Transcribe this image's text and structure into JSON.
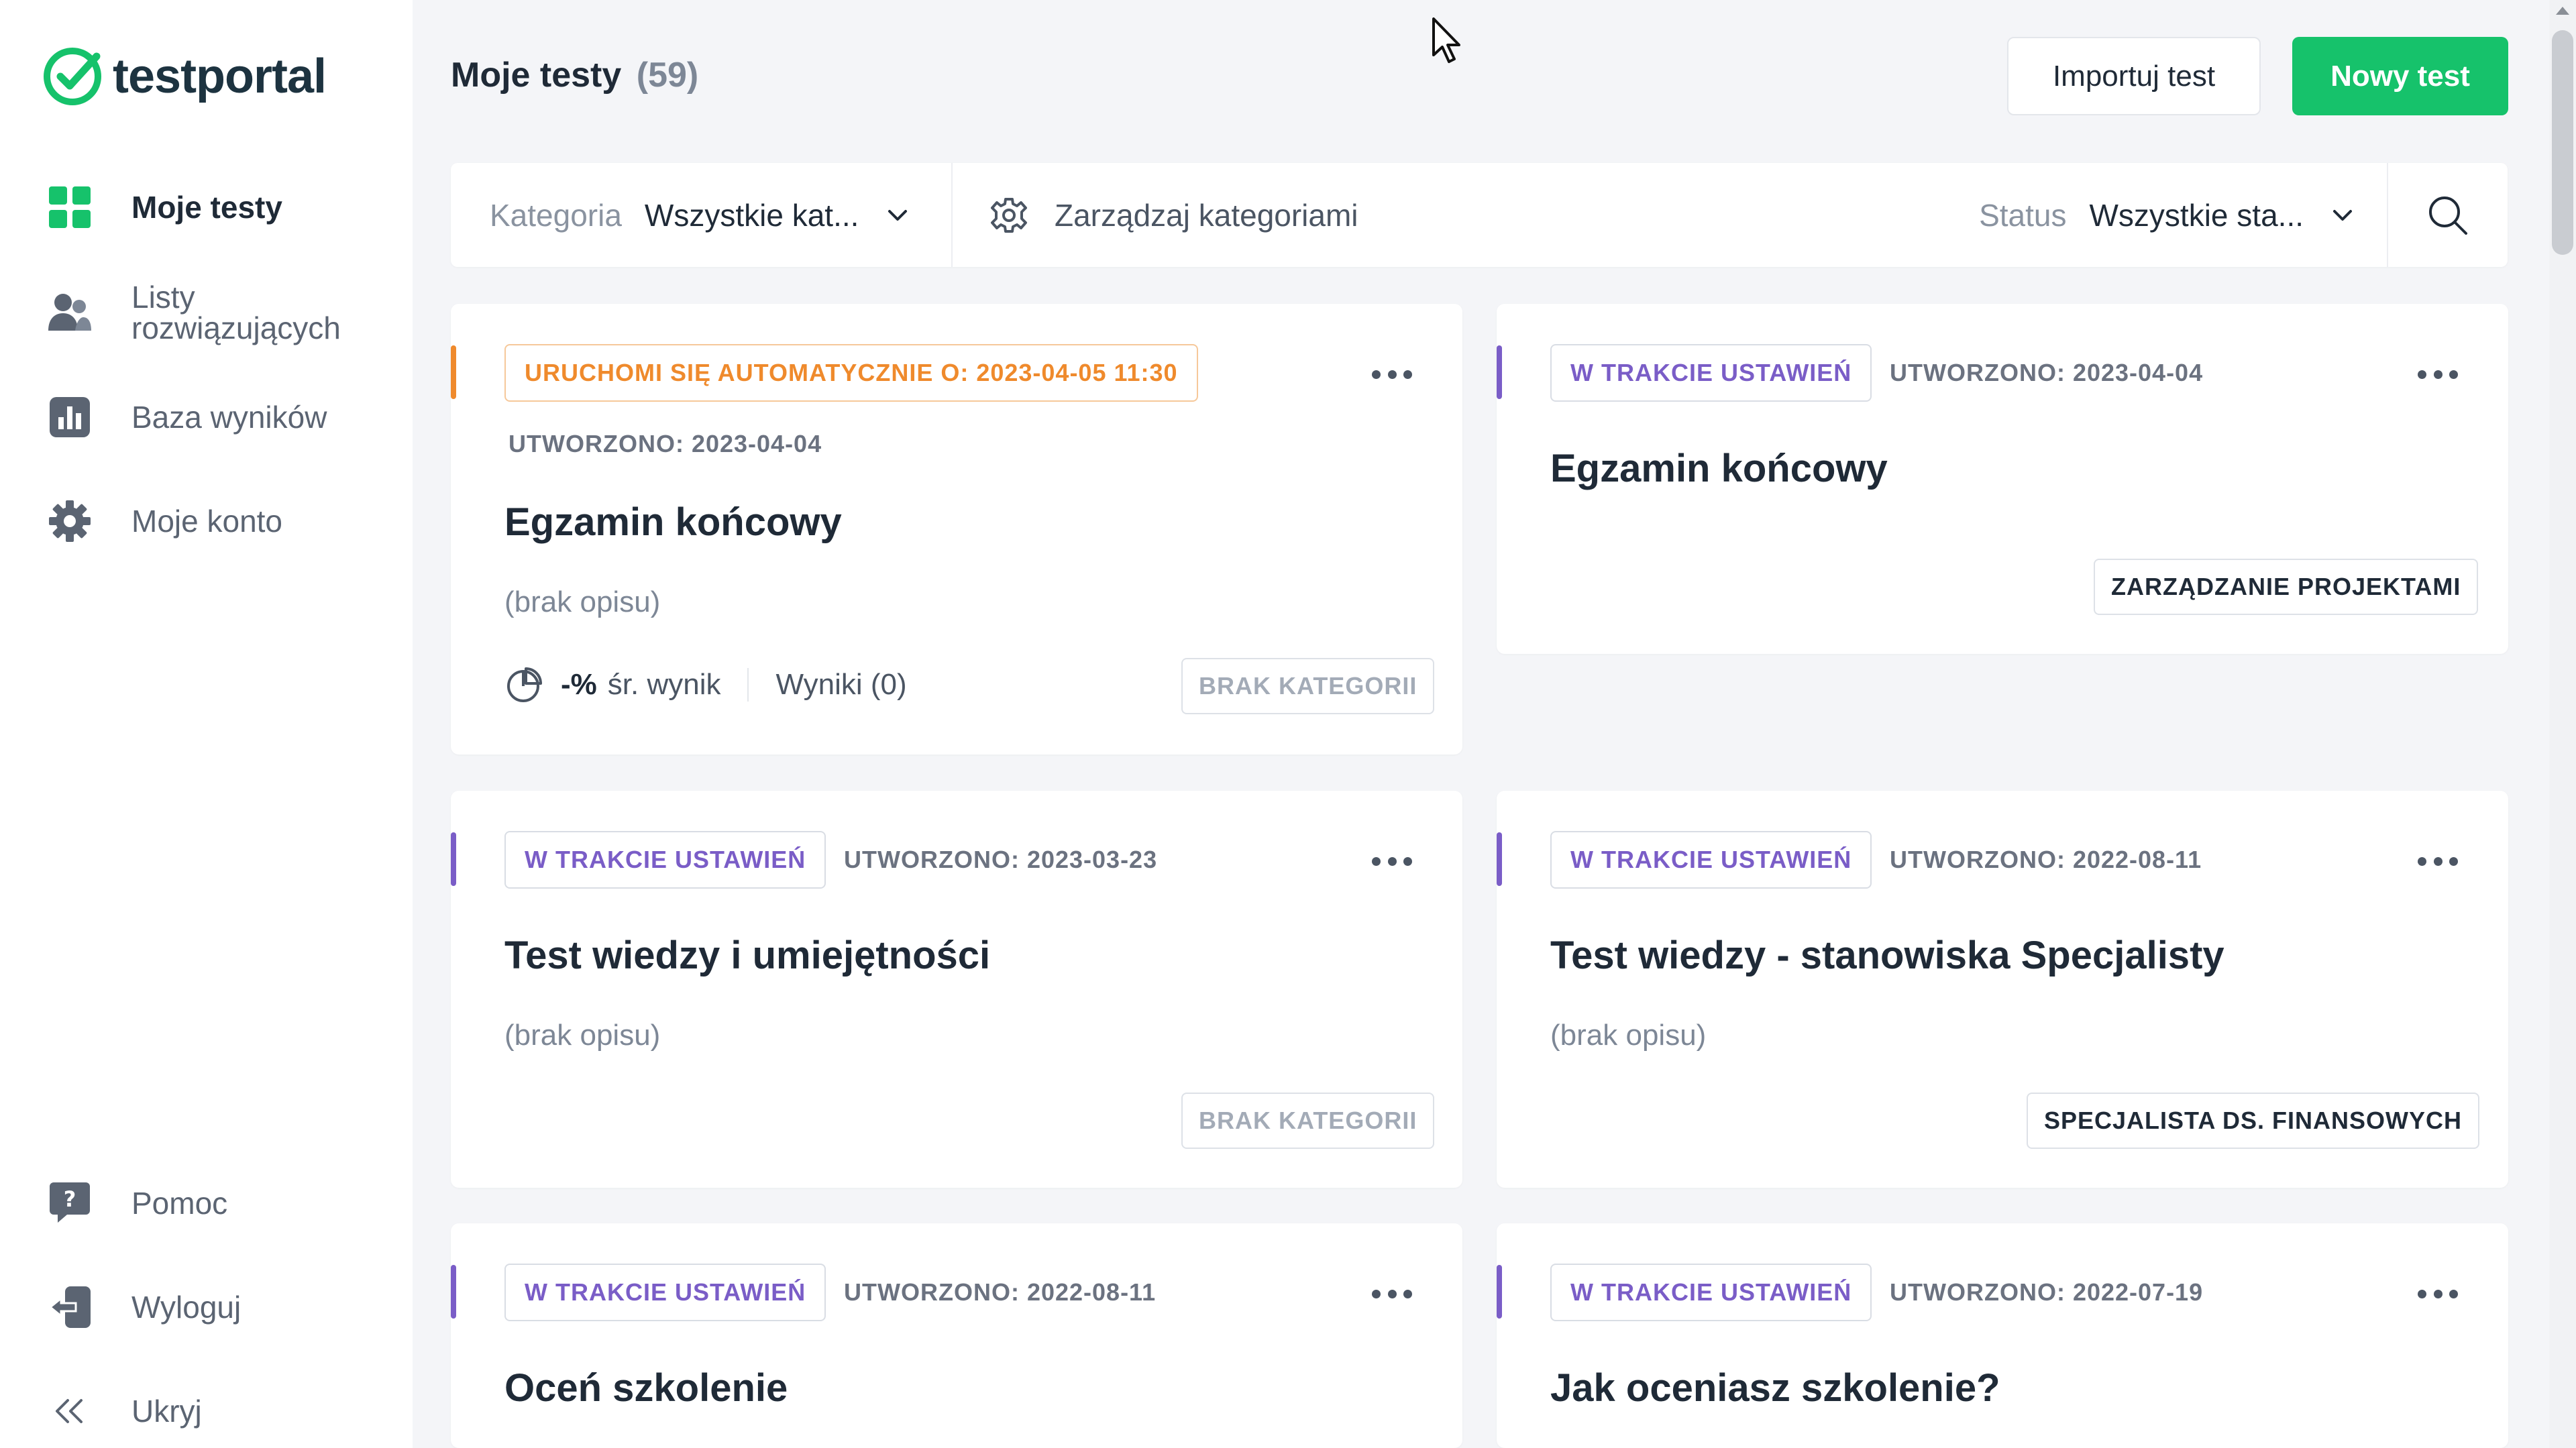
{
  "app": {
    "name": "testportal"
  },
  "sidebar": {
    "items": [
      {
        "label": "Moje testy",
        "icon": "grid-icon",
        "active": true
      },
      {
        "label": "Listy rozwiązujących",
        "icon": "users-icon"
      },
      {
        "label": "Baza wyników",
        "icon": "bar-chart-icon"
      },
      {
        "label": "Moje konto",
        "icon": "gear-icon"
      }
    ],
    "bottom": [
      {
        "label": "Pomoc",
        "icon": "help-icon"
      },
      {
        "label": "Wyloguj",
        "icon": "logout-icon"
      },
      {
        "label": "Ukryj",
        "icon": "double-chevron-left-icon"
      }
    ]
  },
  "header": {
    "title": "Moje testy",
    "count": "(59)",
    "import_label": "Importuj test",
    "new_label": "Nowy test"
  },
  "filters": {
    "category_label": "Kategoria",
    "category_value": "Wszystkie kat...",
    "manage_label": "Zarządzaj kategoriami",
    "status_label": "Status",
    "status_value": "Wszystkie sta..."
  },
  "cards": [
    {
      "status": "URUCHOMI SIĘ AUTOMATYCZNIE O: 2023-04-05 11:30",
      "created": "UTWORZONO: 2023-04-04",
      "title": "Egzamin końcowy",
      "description": "(brak opisu)",
      "avg_pct": "-%",
      "avg_label": "śr. wynik",
      "results": "Wyniki (0)",
      "tag": "BRAK KATEGORII"
    },
    {
      "status": "W TRAKCIE USTAWIEŃ",
      "created": "UTWORZONO: 2023-04-04",
      "title": "Egzamin końcowy",
      "tag": "ZARZĄDZANIE PROJEKTAMI"
    },
    {
      "status": "W TRAKCIE USTAWIEŃ",
      "created": "UTWORZONO: 2023-03-23",
      "title": "Test wiedzy i umiejętności",
      "description": "(brak opisu)",
      "tag": "BRAK KATEGORII"
    },
    {
      "status": "W TRAKCIE USTAWIEŃ",
      "created": "UTWORZONO: 2022-08-11",
      "title": "Test wiedzy - stanowiska Specjalisty",
      "description": "(brak opisu)",
      "tag": "SPECJALISTA DS. FINANSOWYCH"
    },
    {
      "status": "W TRAKCIE USTAWIEŃ",
      "created": "UTWORZONO: 2022-08-11",
      "title": "Oceń szkolenie"
    },
    {
      "status": "W TRAKCIE USTAWIEŃ",
      "created": "UTWORZONO: 2022-07-19",
      "title": "Jak oceniasz szkolenie?"
    }
  ],
  "colors": {
    "brand_green": "#16c26b",
    "accent_purple": "#7a5dc7",
    "accent_orange": "#ef8a2c"
  }
}
